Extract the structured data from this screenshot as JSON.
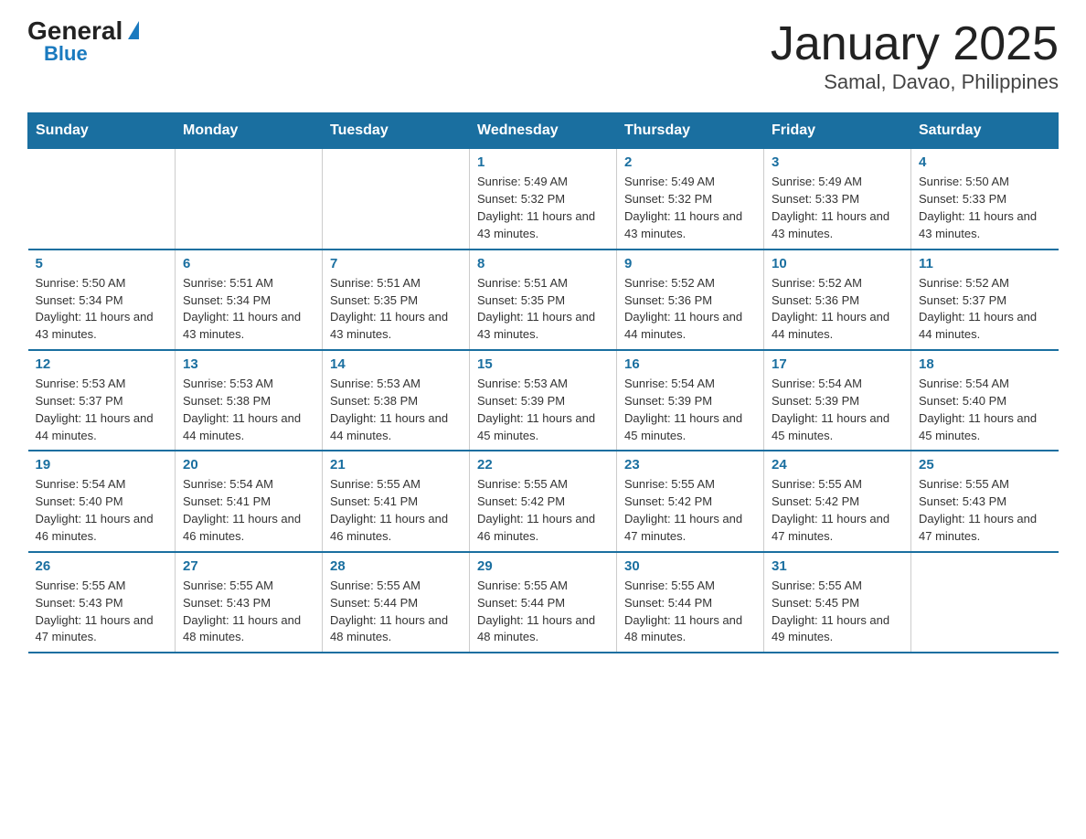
{
  "logo": {
    "general": "General",
    "blue": "Blue",
    "arrow": "▶"
  },
  "title": "January 2025",
  "subtitle": "Samal, Davao, Philippines",
  "headers": [
    "Sunday",
    "Monday",
    "Tuesday",
    "Wednesday",
    "Thursday",
    "Friday",
    "Saturday"
  ],
  "weeks": [
    [
      {
        "day": "",
        "info": ""
      },
      {
        "day": "",
        "info": ""
      },
      {
        "day": "",
        "info": ""
      },
      {
        "day": "1",
        "info": "Sunrise: 5:49 AM\nSunset: 5:32 PM\nDaylight: 11 hours and 43 minutes."
      },
      {
        "day": "2",
        "info": "Sunrise: 5:49 AM\nSunset: 5:32 PM\nDaylight: 11 hours and 43 minutes."
      },
      {
        "day": "3",
        "info": "Sunrise: 5:49 AM\nSunset: 5:33 PM\nDaylight: 11 hours and 43 minutes."
      },
      {
        "day": "4",
        "info": "Sunrise: 5:50 AM\nSunset: 5:33 PM\nDaylight: 11 hours and 43 minutes."
      }
    ],
    [
      {
        "day": "5",
        "info": "Sunrise: 5:50 AM\nSunset: 5:34 PM\nDaylight: 11 hours and 43 minutes."
      },
      {
        "day": "6",
        "info": "Sunrise: 5:51 AM\nSunset: 5:34 PM\nDaylight: 11 hours and 43 minutes."
      },
      {
        "day": "7",
        "info": "Sunrise: 5:51 AM\nSunset: 5:35 PM\nDaylight: 11 hours and 43 minutes."
      },
      {
        "day": "8",
        "info": "Sunrise: 5:51 AM\nSunset: 5:35 PM\nDaylight: 11 hours and 43 minutes."
      },
      {
        "day": "9",
        "info": "Sunrise: 5:52 AM\nSunset: 5:36 PM\nDaylight: 11 hours and 44 minutes."
      },
      {
        "day": "10",
        "info": "Sunrise: 5:52 AM\nSunset: 5:36 PM\nDaylight: 11 hours and 44 minutes."
      },
      {
        "day": "11",
        "info": "Sunrise: 5:52 AM\nSunset: 5:37 PM\nDaylight: 11 hours and 44 minutes."
      }
    ],
    [
      {
        "day": "12",
        "info": "Sunrise: 5:53 AM\nSunset: 5:37 PM\nDaylight: 11 hours and 44 minutes."
      },
      {
        "day": "13",
        "info": "Sunrise: 5:53 AM\nSunset: 5:38 PM\nDaylight: 11 hours and 44 minutes."
      },
      {
        "day": "14",
        "info": "Sunrise: 5:53 AM\nSunset: 5:38 PM\nDaylight: 11 hours and 44 minutes."
      },
      {
        "day": "15",
        "info": "Sunrise: 5:53 AM\nSunset: 5:39 PM\nDaylight: 11 hours and 45 minutes."
      },
      {
        "day": "16",
        "info": "Sunrise: 5:54 AM\nSunset: 5:39 PM\nDaylight: 11 hours and 45 minutes."
      },
      {
        "day": "17",
        "info": "Sunrise: 5:54 AM\nSunset: 5:39 PM\nDaylight: 11 hours and 45 minutes."
      },
      {
        "day": "18",
        "info": "Sunrise: 5:54 AM\nSunset: 5:40 PM\nDaylight: 11 hours and 45 minutes."
      }
    ],
    [
      {
        "day": "19",
        "info": "Sunrise: 5:54 AM\nSunset: 5:40 PM\nDaylight: 11 hours and 46 minutes."
      },
      {
        "day": "20",
        "info": "Sunrise: 5:54 AM\nSunset: 5:41 PM\nDaylight: 11 hours and 46 minutes."
      },
      {
        "day": "21",
        "info": "Sunrise: 5:55 AM\nSunset: 5:41 PM\nDaylight: 11 hours and 46 minutes."
      },
      {
        "day": "22",
        "info": "Sunrise: 5:55 AM\nSunset: 5:42 PM\nDaylight: 11 hours and 46 minutes."
      },
      {
        "day": "23",
        "info": "Sunrise: 5:55 AM\nSunset: 5:42 PM\nDaylight: 11 hours and 47 minutes."
      },
      {
        "day": "24",
        "info": "Sunrise: 5:55 AM\nSunset: 5:42 PM\nDaylight: 11 hours and 47 minutes."
      },
      {
        "day": "25",
        "info": "Sunrise: 5:55 AM\nSunset: 5:43 PM\nDaylight: 11 hours and 47 minutes."
      }
    ],
    [
      {
        "day": "26",
        "info": "Sunrise: 5:55 AM\nSunset: 5:43 PM\nDaylight: 11 hours and 47 minutes."
      },
      {
        "day": "27",
        "info": "Sunrise: 5:55 AM\nSunset: 5:43 PM\nDaylight: 11 hours and 48 minutes."
      },
      {
        "day": "28",
        "info": "Sunrise: 5:55 AM\nSunset: 5:44 PM\nDaylight: 11 hours and 48 minutes."
      },
      {
        "day": "29",
        "info": "Sunrise: 5:55 AM\nSunset: 5:44 PM\nDaylight: 11 hours and 48 minutes."
      },
      {
        "day": "30",
        "info": "Sunrise: 5:55 AM\nSunset: 5:44 PM\nDaylight: 11 hours and 48 minutes."
      },
      {
        "day": "31",
        "info": "Sunrise: 5:55 AM\nSunset: 5:45 PM\nDaylight: 11 hours and 49 minutes."
      },
      {
        "day": "",
        "info": ""
      }
    ]
  ]
}
